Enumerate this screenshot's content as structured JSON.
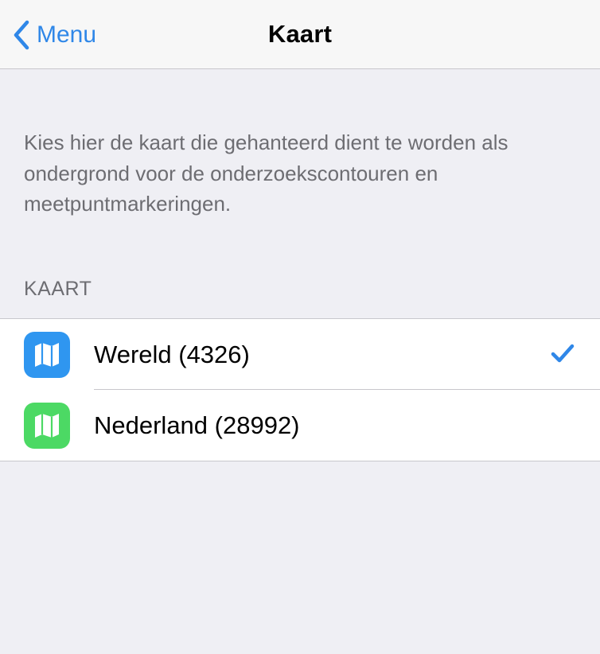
{
  "navbar": {
    "back_label": "Menu",
    "title": "Kaart"
  },
  "description": "Kies hier de kaart die gehanteerd dient te worden als ondergrond voor de onderzoekscontouren en meetpuntmarkeringen.",
  "section": {
    "header": "KAART",
    "items": [
      {
        "label": "Wereld (4326)",
        "icon": "map-icon",
        "icon_color": "#2f96f0",
        "selected": true
      },
      {
        "label": "Nederland (28992)",
        "icon": "map-icon",
        "icon_color": "#4cd964",
        "selected": false
      }
    ]
  },
  "colors": {
    "accent": "#2f87e8",
    "background": "#efeff4"
  }
}
